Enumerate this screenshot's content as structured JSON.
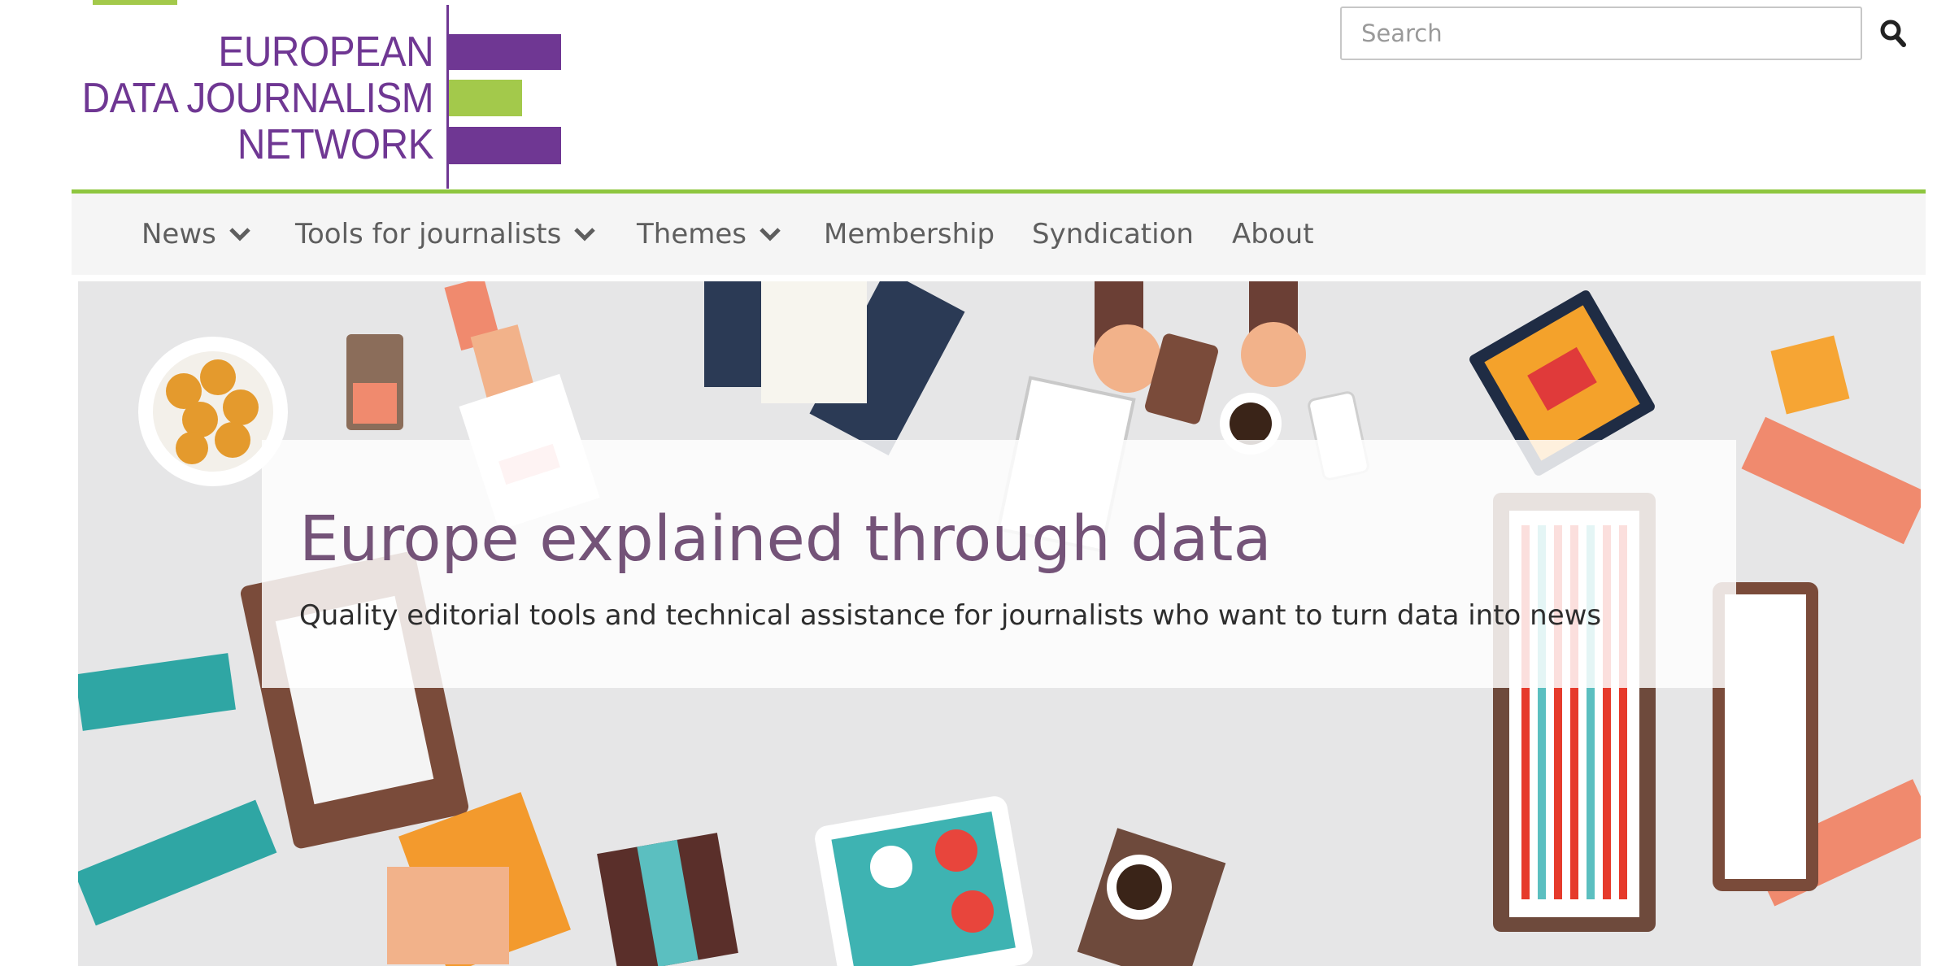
{
  "logo": {
    "lines": [
      "EUROPEAN",
      "DATA JOURNALISM",
      "NETWORK"
    ]
  },
  "search": {
    "placeholder": "Search",
    "icon": "search-icon"
  },
  "nav": {
    "items": [
      {
        "label": "News",
        "has_dropdown": true
      },
      {
        "label": "Tools for journalists",
        "has_dropdown": true
      },
      {
        "label": "Themes",
        "has_dropdown": true
      },
      {
        "label": "Membership",
        "has_dropdown": false
      },
      {
        "label": "Syndication",
        "has_dropdown": false
      },
      {
        "label": "About",
        "has_dropdown": false
      }
    ]
  },
  "hero": {
    "title": "Europe explained through data",
    "subtitle": "Quality editorial tools and technical assistance for journalists who want to turn data into news"
  },
  "colors": {
    "brand_purple": "#6f3793",
    "brand_green": "#a3c94b",
    "nav_rule_green": "#8ec63f",
    "title_purple": "#745378"
  }
}
